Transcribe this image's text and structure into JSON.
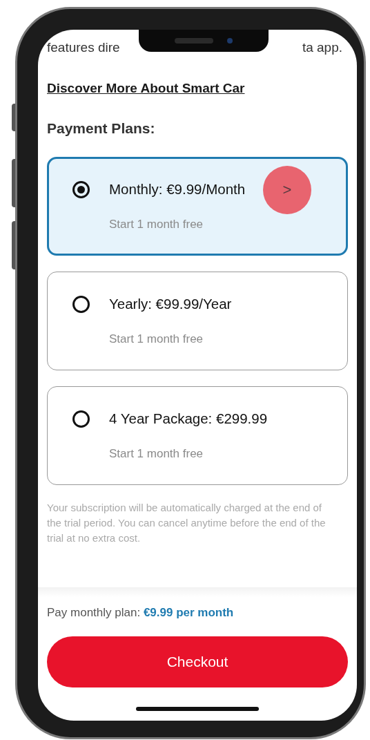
{
  "top_text": {
    "left": "features dire",
    "right": "ta app."
  },
  "link": "Discover More About Smart Car",
  "section_title": "Payment Plans:",
  "plans": [
    {
      "title": "Monthly: €9.99/Month",
      "subtitle": "Start 1 month free",
      "selected": true,
      "tap_indicator": ">"
    },
    {
      "title": "Yearly: €99.99/Year",
      "subtitle": "Start 1 month free",
      "selected": false
    },
    {
      "title": "4 Year Package: €299.99",
      "subtitle": "Start 1 month free",
      "selected": false
    }
  ],
  "disclaimer": "Your subscription will be automatically charged at the end of the trial period. You can cancel anytime before the end of the trial at no extra cost.",
  "summary": {
    "label": "Pay monthly plan:",
    "amount": "€9.99 per month"
  },
  "checkout": "Checkout"
}
